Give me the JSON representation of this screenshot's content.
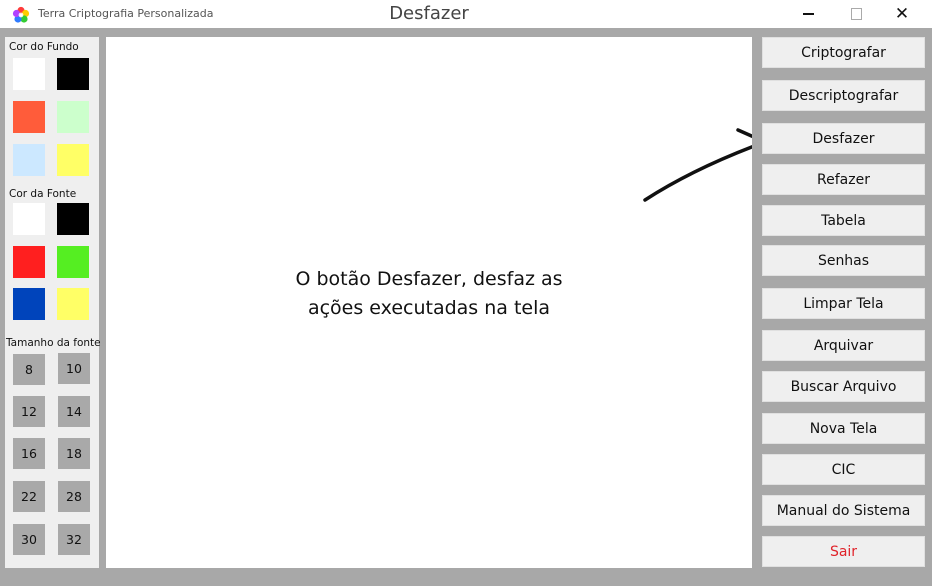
{
  "titlebar": {
    "app_name": "Terra Criptografia Personalizada",
    "window_title": "Desfazer",
    "close_glyph": "✕"
  },
  "left_panel": {
    "background_label": "Cor do Fundo",
    "background_colors": [
      "#ffffff",
      "#000000",
      "#ff5c3a",
      "#ccffcc",
      "#cce8ff",
      "#ffff66"
    ],
    "font_label": "Cor da Fonte",
    "font_colors": [
      "#ffffff",
      "#000000",
      "#ff1f1f",
      "#55ee22",
      "#0044bb",
      "#ffff66"
    ],
    "size_label": "Tamanho da fonte",
    "sizes": [
      "8",
      "10",
      "12",
      "14",
      "16",
      "18",
      "22",
      "28",
      "30",
      "32"
    ]
  },
  "canvas": {
    "line1": "O botão Desfazer, desfaz as",
    "line2": "ações executadas na tela"
  },
  "actions": [
    "Criptografar",
    "Descriptografar",
    "Desfazer",
    "Refazer",
    "Tabela",
    "Senhas",
    "Limpar Tela",
    "Arquivar",
    "Buscar Arquivo",
    "Nova Tela",
    "CIC",
    "Manual do Sistema",
    "Sair"
  ]
}
